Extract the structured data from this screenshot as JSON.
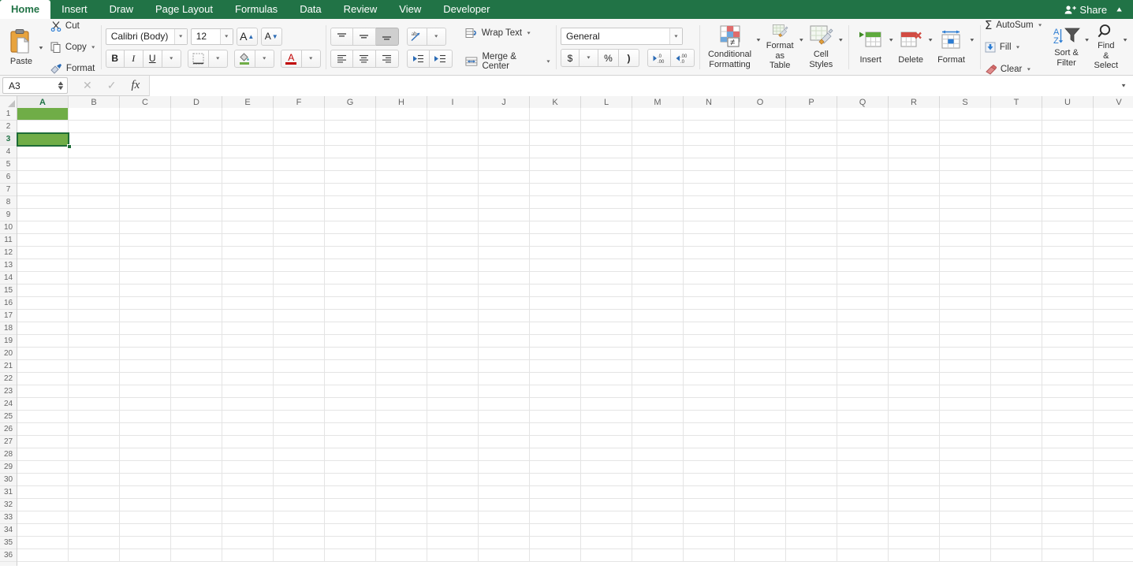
{
  "app": {
    "accent_green": "#217346",
    "cell_fill_green": "#70ad47",
    "selection_border": "#1e6c37"
  },
  "tabbar": {
    "tabs": [
      {
        "label": "Home",
        "active": true
      },
      {
        "label": "Insert",
        "active": false
      },
      {
        "label": "Draw",
        "active": false
      },
      {
        "label": "Page Layout",
        "active": false
      },
      {
        "label": "Formulas",
        "active": false
      },
      {
        "label": "Data",
        "active": false
      },
      {
        "label": "Review",
        "active": false
      },
      {
        "label": "View",
        "active": false
      },
      {
        "label": "Developer",
        "active": false
      }
    ],
    "share_label": "Share",
    "share_icon": "person-add-icon",
    "collapse_icon": "chevron-up-icon"
  },
  "ribbon": {
    "clipboard": {
      "paste_label": "Paste",
      "paste_icon": "clipboard-icon",
      "cut_label": "Cut",
      "cut_icon": "scissors-icon",
      "copy_label": "Copy",
      "copy_icon": "copy-icon",
      "format_label": "Format",
      "format_icon": "format-painter-icon"
    },
    "font": {
      "font_name": "Calibri (Body)",
      "font_size": "12",
      "grow_font_label": "A",
      "shrink_font_label": "A",
      "bold_label": "B",
      "italic_label": "I",
      "underline_label": "U",
      "borders_icon": "borders-icon",
      "fill_color_icon": "fill-color-icon",
      "font_color_label": "A",
      "font_color_icon": "font-color-icon"
    },
    "alignment": {
      "align_top_icon": "align-top-icon",
      "align_middle_icon": "align-middle-icon",
      "align_bottom_icon": "align-bottom-icon",
      "align_bottom_active": true,
      "orientation_icon": "orientation-icon",
      "align_left_icon": "align-left-icon",
      "align_center_icon": "align-center-icon",
      "align_right_icon": "align-right-icon",
      "decrease_indent_icon": "decrease-indent-icon",
      "increase_indent_icon": "increase-indent-icon",
      "wrap_text_label": "Wrap Text",
      "wrap_text_icon": "wrap-text-icon",
      "merge_center_label": "Merge & Center",
      "merge_center_icon": "merge-cells-icon"
    },
    "number": {
      "format_value": "General",
      "currency_label": "$",
      "percent_label": "%",
      "comma_label": ")",
      "increase_decimal_label": ".00",
      "decrease_decimal_label": ".00"
    },
    "styles": {
      "conditional_formatting_line1": "Conditional",
      "conditional_formatting_line2": "Formatting",
      "conditional_formatting_icon": "conditional-formatting-icon",
      "format_as_table_line1": "Format",
      "format_as_table_line2": "as Table",
      "format_as_table_icon": "format-as-table-icon",
      "cell_styles_line1": "Cell",
      "cell_styles_line2": "Styles",
      "cell_styles_icon": "cell-styles-icon"
    },
    "cells": {
      "insert_label": "Insert",
      "insert_icon": "insert-cells-icon",
      "delete_label": "Delete",
      "delete_icon": "delete-cells-icon",
      "format_label": "Format",
      "format_icon": "format-cells-icon"
    },
    "editing": {
      "autosum_label": "AutoSum",
      "autosum_icon": "sigma-icon",
      "fill_label": "Fill",
      "fill_icon": "fill-down-icon",
      "clear_label": "Clear",
      "clear_icon": "eraser-icon",
      "sort_filter_line1": "Sort &",
      "sort_filter_line2": "Filter",
      "sort_filter_icon": "sort-filter-icon",
      "find_select_line1": "Find &",
      "find_select_line2": "Select",
      "find_select_icon": "magnifier-icon"
    }
  },
  "formula_bar": {
    "name_box_value": "A3",
    "name_box_icon": "spinner-icon",
    "cancel_icon": "x-icon",
    "confirm_icon": "check-icon",
    "function_icon": "fx-icon",
    "formula_value": "",
    "expand_icon": "chevron-down-icon"
  },
  "grid": {
    "columns": [
      "A",
      "B",
      "C",
      "D",
      "E",
      "F",
      "G",
      "H",
      "I",
      "J",
      "K",
      "L",
      "M",
      "N",
      "O",
      "P",
      "Q",
      "R",
      "S",
      "T",
      "U",
      "V"
    ],
    "selected_column": "A",
    "rows": [
      1,
      2,
      3,
      4,
      5,
      6,
      7,
      8,
      9,
      10,
      11,
      12,
      13,
      14,
      15,
      16,
      17,
      18,
      19,
      20,
      21,
      22,
      23,
      24,
      25,
      26,
      27,
      28,
      29,
      30,
      31,
      32,
      33,
      34,
      35,
      36
    ],
    "selected_row": 3,
    "active_cell": "A3",
    "filled_cells": [
      "A1",
      "A3"
    ],
    "cell_values": {}
  }
}
